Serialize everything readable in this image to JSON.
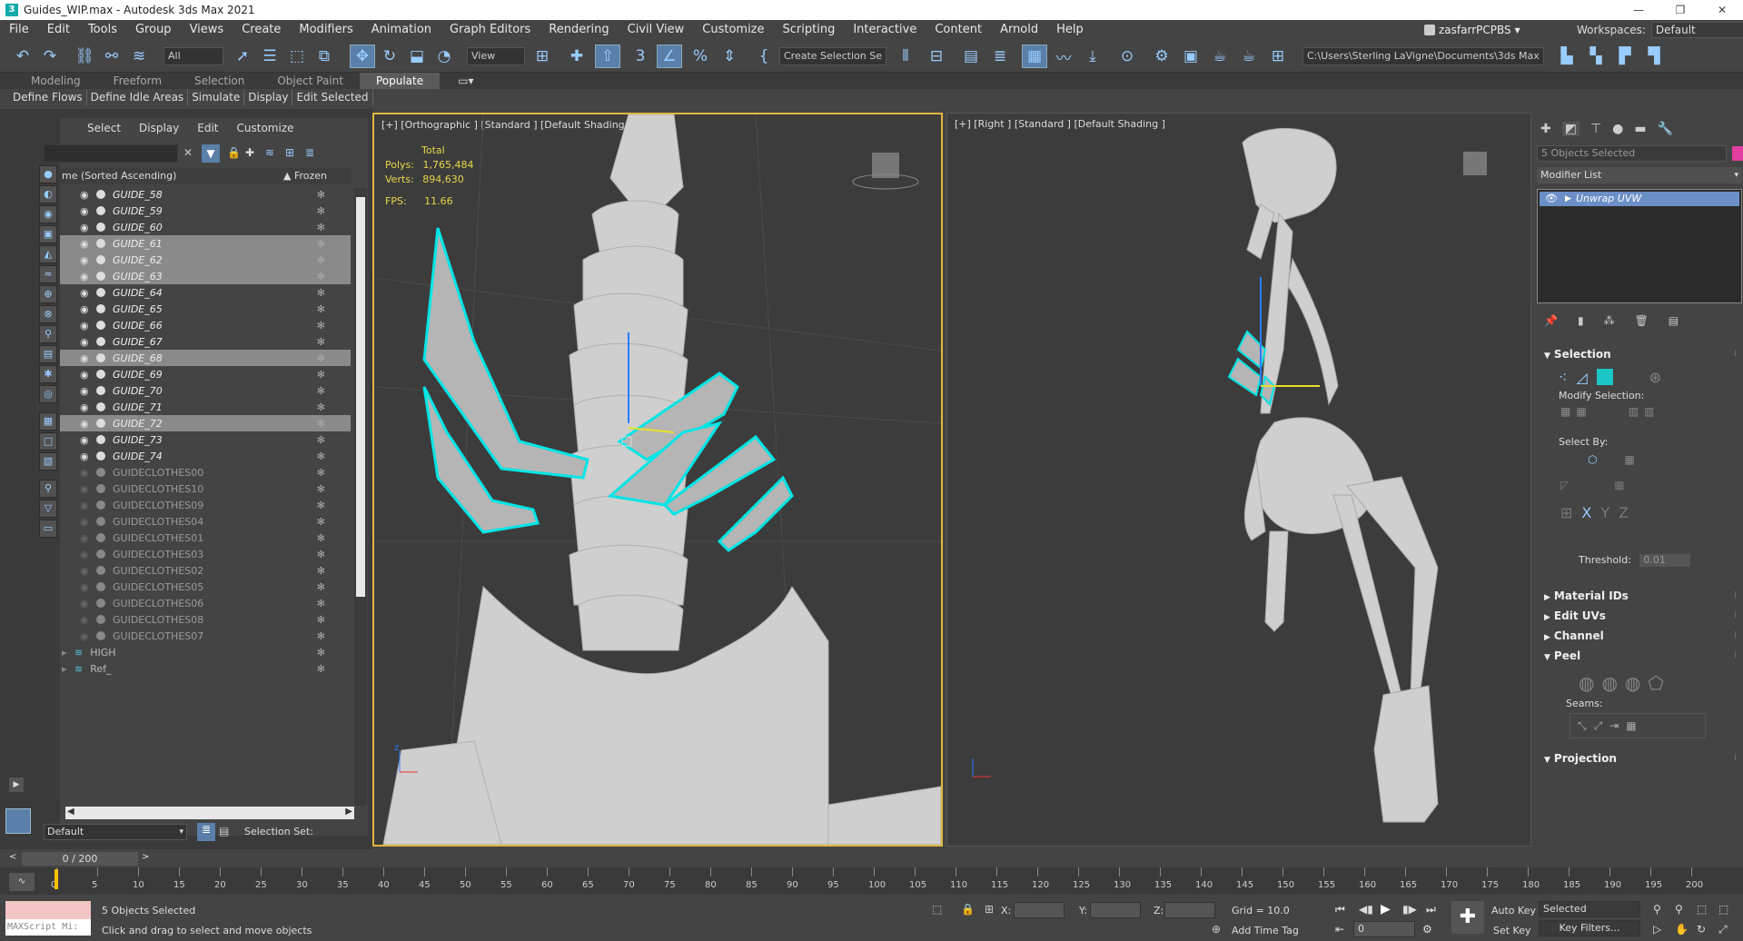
{
  "window": {
    "title": "Guides_WIP.max - Autodesk 3ds Max 2021",
    "min": "—",
    "max": "❐",
    "close": "✕"
  },
  "menu": [
    "File",
    "Edit",
    "Tools",
    "Group",
    "Views",
    "Create",
    "Modifiers",
    "Animation",
    "Graph Editors",
    "Rendering",
    "Civil View",
    "Customize",
    "Scripting",
    "Interactive",
    "Content",
    "Arnold",
    "Help"
  ],
  "user": {
    "name": "zasfarrPCPBS",
    "workspaces_label": "Workspaces:",
    "workspace": "Default"
  },
  "toolbar": {
    "filter": "All",
    "refcoord": "View",
    "selection_set": "Create Selection Se",
    "project_path": "C:\\Users\\Sterling LaVigne\\Documents\\3ds Max 2021"
  },
  "ribbon": {
    "tabs": [
      "Modeling",
      "Freeform",
      "Selection",
      "Object Paint",
      "Populate"
    ],
    "active": "Populate",
    "buttons": [
      "Define Flows",
      "Define Idle Areas",
      "Simulate",
      "Display",
      "Edit Selected"
    ]
  },
  "scene_explorer": {
    "menu": [
      "Select",
      "Display",
      "Edit",
      "Customize"
    ],
    "col_name": "me (Sorted Ascending)",
    "col_frozen": "▲ Frozen",
    "rows": [
      {
        "name": "GUIDE_58",
        "state": "vis"
      },
      {
        "name": "GUIDE_59",
        "state": "vis"
      },
      {
        "name": "GUIDE_60",
        "state": "vis"
      },
      {
        "name": "GUIDE_61",
        "state": "sel"
      },
      {
        "name": "GUIDE_62",
        "state": "sel"
      },
      {
        "name": "GUIDE_63",
        "state": "sel"
      },
      {
        "name": "GUIDE_64",
        "state": "vis"
      },
      {
        "name": "GUIDE_65",
        "state": "vis"
      },
      {
        "name": "GUIDE_66",
        "state": "vis"
      },
      {
        "name": "GUIDE_67",
        "state": "vis"
      },
      {
        "name": "GUIDE_68",
        "state": "sel"
      },
      {
        "name": "GUIDE_69",
        "state": "vis"
      },
      {
        "name": "GUIDE_70",
        "state": "vis"
      },
      {
        "name": "GUIDE_71",
        "state": "vis"
      },
      {
        "name": "GUIDE_72",
        "state": "sel"
      },
      {
        "name": "GUIDE_73",
        "state": "vis"
      },
      {
        "name": "GUIDE_74",
        "state": "vis"
      },
      {
        "name": "GUIDECLOTHES00",
        "state": "hidden"
      },
      {
        "name": "GUIDECLOTHES10",
        "state": "hidden"
      },
      {
        "name": "GUIDECLOTHES09",
        "state": "hidden"
      },
      {
        "name": "GUIDECLOTHES04",
        "state": "hidden"
      },
      {
        "name": "GUIDECLOTHES01",
        "state": "hidden"
      },
      {
        "name": "GUIDECLOTHES03",
        "state": "hidden"
      },
      {
        "name": "GUIDECLOTHES02",
        "state": "hidden"
      },
      {
        "name": "GUIDECLOTHES05",
        "state": "hidden"
      },
      {
        "name": "GUIDECLOTHES06",
        "state": "hidden"
      },
      {
        "name": "GUIDECLOTHES08",
        "state": "hidden"
      },
      {
        "name": "GUIDECLOTHES07",
        "state": "hidden"
      },
      {
        "name": "HIGH",
        "state": "layer"
      },
      {
        "name": "Ref_",
        "state": "layer"
      }
    ],
    "layer": "Default",
    "selection_set_label": "Selection Set:"
  },
  "viewport_left": {
    "label": "[+] [Orthographic ] [Standard ] [Default Shading ]",
    "total_label": "Total",
    "polys_label": "Polys:",
    "polys": "1,765,484",
    "verts_label": "Verts:",
    "verts": "894,630",
    "fps_label": "FPS:",
    "fps": "11.66"
  },
  "viewport_right": {
    "label": "[+] [Right ] [Standard ] [Default Shading ]"
  },
  "command_panel": {
    "object_name": "5 Objects Selected",
    "modifier_list": "Modifier List",
    "stack_item": "Unwrap UVW",
    "rollouts": [
      "Selection",
      "Material IDs",
      "Edit UVs",
      "Channel",
      "Peel",
      "Projection"
    ],
    "modify_selection": "Modify Selection:",
    "select_by": "Select By:",
    "threshold_label": "Threshold:",
    "threshold": "0.01",
    "seams": "Seams:"
  },
  "timeline": {
    "frame": "0 / 200",
    "ticks": [
      "0",
      "5",
      "10",
      "15",
      "20",
      "25",
      "30",
      "35",
      "40",
      "45",
      "50",
      "55",
      "60",
      "65",
      "70",
      "75",
      "80",
      "85",
      "90",
      "95",
      "100",
      "105",
      "110",
      "115",
      "120",
      "125",
      "130",
      "135",
      "140",
      "145",
      "150",
      "155",
      "160",
      "165",
      "170",
      "175",
      "180",
      "185",
      "190",
      "195",
      "200"
    ]
  },
  "status": {
    "maxscript": "MAXScript Mi:",
    "selected": "5 Objects Selected",
    "prompt": "Click and drag to select and move objects",
    "x": "X:",
    "y": "Y:",
    "z": "Z:",
    "grid": "Grid = 10.0",
    "add_time_tag": "Add Time Tag",
    "auto_key": "Auto Key",
    "set_key": "Set Key",
    "selected_combo": "Selected",
    "key_filters": "Key Filters...",
    "frame_field": "0"
  }
}
